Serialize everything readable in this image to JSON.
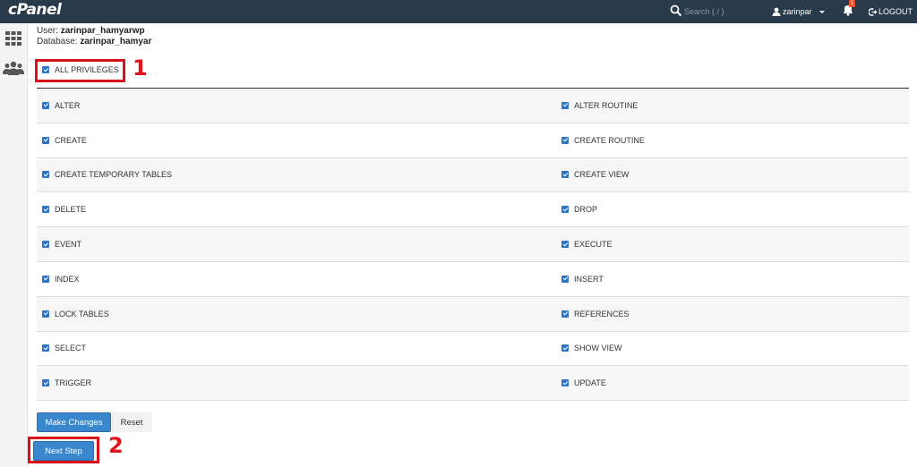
{
  "brand": {
    "logo_text": "cPanel"
  },
  "header": {
    "search_placeholder": "Search ( / )",
    "username": "zarinpar",
    "notification_count": "1",
    "logout_label": "LOGOUT"
  },
  "sidebar": {
    "items": [
      {
        "icon": "grid-icon"
      },
      {
        "icon": "users-icon"
      }
    ]
  },
  "meta": {
    "user_label": "User:",
    "user_value": "zarinpar_hamyarwp",
    "database_label": "Database:",
    "database_value": "zarinpar_hamyar"
  },
  "all_privileges": {
    "label": "ALL PRIVILEGES",
    "checked": true
  },
  "annotations": {
    "first": "1",
    "second": "2"
  },
  "privileges": [
    {
      "left": "ALTER",
      "right": "ALTER ROUTINE"
    },
    {
      "left": "CREATE",
      "right": "CREATE ROUTINE"
    },
    {
      "left": "CREATE TEMPORARY TABLES",
      "right": "CREATE VIEW"
    },
    {
      "left": "DELETE",
      "right": "DROP"
    },
    {
      "left": "EVENT",
      "right": "EXECUTE"
    },
    {
      "left": "INDEX",
      "right": "INSERT"
    },
    {
      "left": "LOCK TABLES",
      "right": "REFERENCES"
    },
    {
      "left": "SELECT",
      "right": "SHOW VIEW"
    },
    {
      "left": "TRIGGER",
      "right": "UPDATE"
    }
  ],
  "actions": {
    "make_changes": "Make Changes",
    "reset": "Reset",
    "next_step": "Next Step"
  },
  "colors": {
    "topbar": "#293a4a",
    "primary": "#3b87ce",
    "highlight": "#d9111b"
  }
}
